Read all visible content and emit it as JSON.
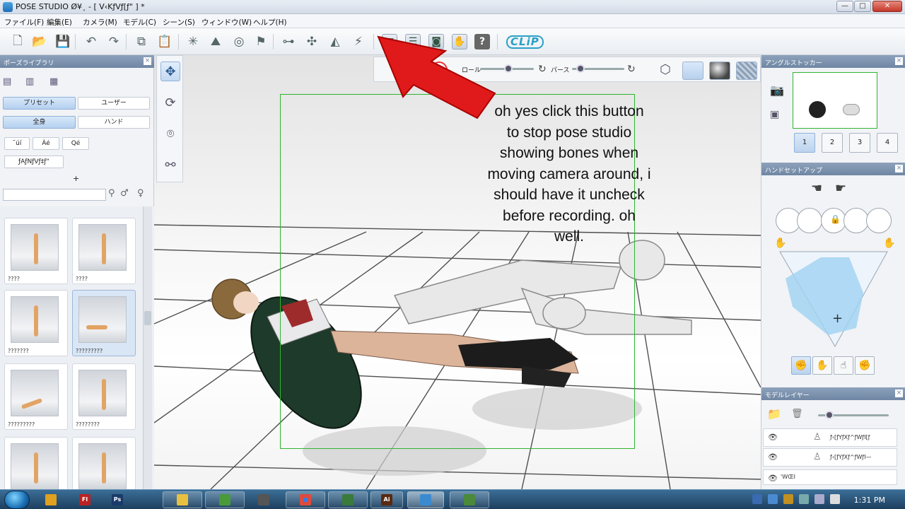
{
  "window": {
    "title": "POSE STUDIO Ø¥¸ - [ V‹KƒVƒ[ƒ\" ] *",
    "min_label": "—",
    "max_label": "□",
    "close_label": "✕"
  },
  "menu": [
    "ファイル(F)",
    "編集(E)",
    "カメラ(M)",
    "モデル(C)",
    "シーン(S)",
    "ウィンドウ(W)",
    "ヘルプ(H)"
  ],
  "toolbar": {
    "help_label": "?",
    "clip_label": "CLiP"
  },
  "pose_library": {
    "title": "ポーズライブラリ",
    "close": "×",
    "tab_preset": "プリセット",
    "tab_user": "ユーザー",
    "filter_body": "全身",
    "filter_hand": "ハンド",
    "cat1": "˜úí",
    "cat2": "Àé",
    "cat3": "Qé",
    "cat4": "ƒAƒNƒVƒ‡ƒ“",
    "add": "+",
    "search_placeholder": "",
    "thumbs": [
      "????",
      "????",
      "???????",
      "?????????",
      "?????????",
      "????????",
      "",
      ""
    ]
  },
  "camera_bar": {
    "roll": "ロール",
    "perspective": "パース"
  },
  "annotation": [
    "oh yes click this button",
    "to stop pose studio",
    "showing bones when",
    "moving camera around, i",
    "should have it uncheck",
    "before recording.   oh",
    "well."
  ],
  "angle_stocker": {
    "title": "アングルストッカー",
    "views": [
      "1",
      "2",
      "3",
      "4"
    ]
  },
  "hand_setup": {
    "title": "ハンドセットアップ",
    "plus": "+"
  },
  "model_layer": {
    "title": "モデルレイヤー",
    "rows": [
      "ƒ‹[ƒYƒXƒ^ƒWƒI[ƒ",
      "ƒ‹[ƒYƒXƒ^ƒWƒI—",
      "'WŒI"
    ]
  },
  "taskbar": {
    "clock": "1:31 PM",
    "apps": [
      "Fl",
      "Ps",
      "",
      "",
      "",
      "",
      "",
      "Ai",
      "",
      ""
    ]
  },
  "colors": {
    "accent": "#2fb52f",
    "panel_header": "#7a8fab",
    "arrow": "#e01a1a"
  }
}
